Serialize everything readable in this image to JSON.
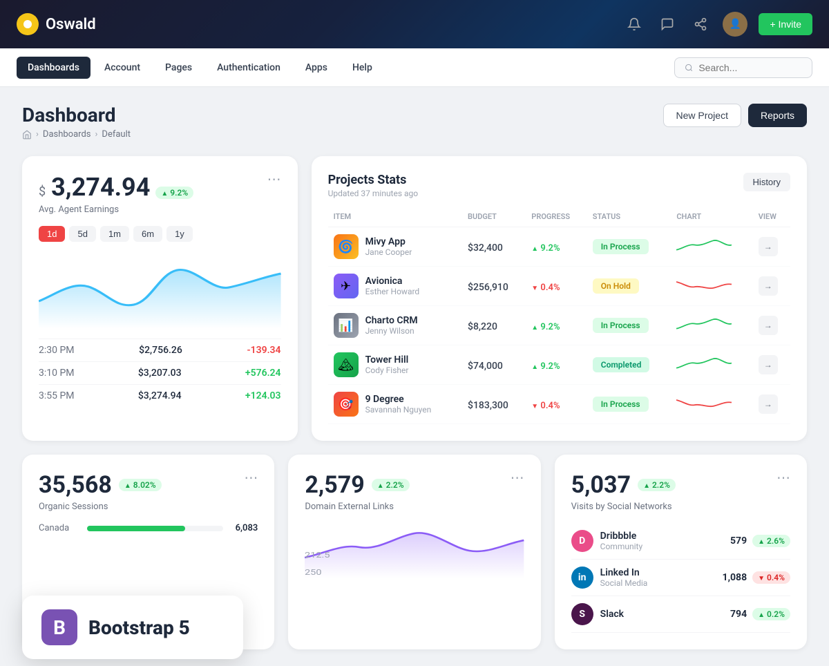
{
  "brand": {
    "name": "Oswald"
  },
  "topbar": {
    "invite_label": "+ Invite"
  },
  "nav": {
    "items": [
      {
        "id": "dashboards",
        "label": "Dashboards",
        "active": true
      },
      {
        "id": "account",
        "label": "Account",
        "active": false
      },
      {
        "id": "pages",
        "label": "Pages",
        "active": false
      },
      {
        "id": "authentication",
        "label": "Authentication",
        "active": false
      },
      {
        "id": "apps",
        "label": "Apps",
        "active": false
      },
      {
        "id": "help",
        "label": "Help",
        "active": false
      }
    ],
    "search_placeholder": "Search..."
  },
  "page": {
    "title": "Dashboard",
    "breadcrumb": [
      "Dashboards",
      "Default"
    ],
    "btn_new_project": "New Project",
    "btn_reports": "Reports"
  },
  "earnings_card": {
    "currency": "$",
    "amount": "3,274.94",
    "badge": "9.2%",
    "subtitle": "Avg. Agent Earnings",
    "filters": [
      "1d",
      "5d",
      "1m",
      "6m",
      "1y"
    ],
    "active_filter": "1d",
    "rows": [
      {
        "time": "2:30 PM",
        "value": "$2,756.26",
        "change": "-139.34",
        "positive": false
      },
      {
        "time": "3:10 PM",
        "value": "$3,207.03",
        "change": "+576.24",
        "positive": true
      },
      {
        "time": "3:55 PM",
        "value": "$3,274.94",
        "change": "+124.03",
        "positive": true
      }
    ]
  },
  "projects_card": {
    "title": "Projects Stats",
    "updated": "Updated 37 minutes ago",
    "btn_history": "History",
    "columns": [
      "ITEM",
      "BUDGET",
      "PROGRESS",
      "STATUS",
      "CHART",
      "VIEW"
    ],
    "projects": [
      {
        "name": "Mivy App",
        "owner": "Jane Cooper",
        "budget": "$32,400",
        "progress": "9.2%",
        "progress_up": true,
        "status": "In Process",
        "status_type": "inprocess",
        "color": "#f97316"
      },
      {
        "name": "Avionica",
        "owner": "Esther Howard",
        "budget": "$256,910",
        "progress": "0.4%",
        "progress_up": false,
        "status": "On Hold",
        "status_type": "onhold",
        "color": "#8b5cf6"
      },
      {
        "name": "Charto CRM",
        "owner": "Jenny Wilson",
        "budget": "$8,220",
        "progress": "9.2%",
        "progress_up": true,
        "status": "In Process",
        "status_type": "inprocess",
        "color": "#6b7280"
      },
      {
        "name": "Tower Hill",
        "owner": "Cody Fisher",
        "budget": "$74,000",
        "progress": "9.2%",
        "progress_up": true,
        "status": "Completed",
        "status_type": "completed",
        "color": "#22c55e"
      },
      {
        "name": "9 Degree",
        "owner": "Savannah Nguyen",
        "budget": "$183,300",
        "progress": "0.4%",
        "progress_up": false,
        "status": "In Process",
        "status_type": "inprocess",
        "color": "#ef4444"
      }
    ]
  },
  "sessions_card": {
    "number": "35,568",
    "badge": "8.02%",
    "label": "Organic Sessions",
    "countries": [
      {
        "name": "Canada",
        "value": "6,083",
        "percent": 72
      }
    ]
  },
  "links_card": {
    "number": "2,579",
    "badge": "2.2%",
    "label": "Domain External Links"
  },
  "social_card": {
    "number": "5,037",
    "badge": "2.2%",
    "label": "Visits by Social Networks",
    "networks": [
      {
        "name": "Dribbble",
        "type": "Community",
        "count": "579",
        "badge": "2.6%",
        "up": true,
        "color": "#ea4c89"
      },
      {
        "name": "Linked In",
        "type": "Social Media",
        "count": "1,088",
        "badge": "0.4%",
        "up": false,
        "color": "#0077b5"
      },
      {
        "name": "Slack",
        "type": "",
        "count": "794",
        "badge": "0.2%",
        "up": true,
        "color": "#4a154b"
      }
    ]
  },
  "bootstrap": {
    "label": "Bootstrap 5",
    "icon_letter": "B"
  }
}
